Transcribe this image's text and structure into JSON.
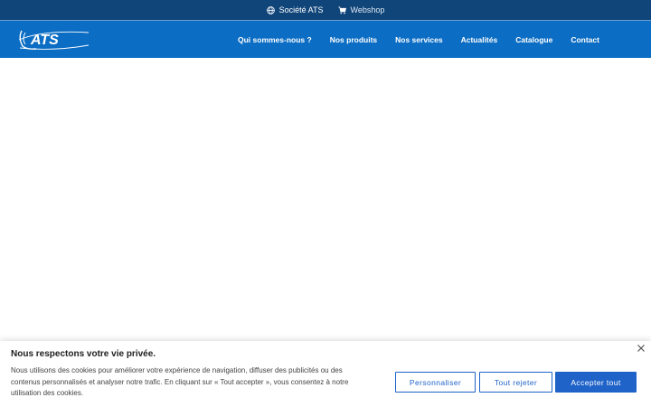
{
  "topbar": {
    "company_label": "Société ATS",
    "webshop_label": "Webshop",
    "company_icon": "globe-icon",
    "webshop_icon": "cart-icon"
  },
  "header": {
    "logo_text": "ATS",
    "menu": [
      {
        "label": "Qui sommes-nous ?"
      },
      {
        "label": "Nos produits"
      },
      {
        "label": "Nos services"
      },
      {
        "label": "Actualités"
      },
      {
        "label": "Catalogue"
      },
      {
        "label": "Contact"
      }
    ]
  },
  "cookie_banner": {
    "title": "Nous respectons votre vie privée.",
    "text": "Nous utilisons des cookies pour améliorer votre expérience de navigation, diffuser des publicités ou des contenus personnalisés et analyser notre trafic. En cliquant sur « Tout accepter », vous consentez à notre utilisation des cookies.",
    "customize_label": "Personnaliser",
    "reject_label": "Tout rejeter",
    "accept_label": "Accepter tout",
    "close_icon": "close-icon"
  },
  "colors": {
    "topbar": "#10457a",
    "nav": "#0b6dc4",
    "accent": "#1f63c9"
  }
}
